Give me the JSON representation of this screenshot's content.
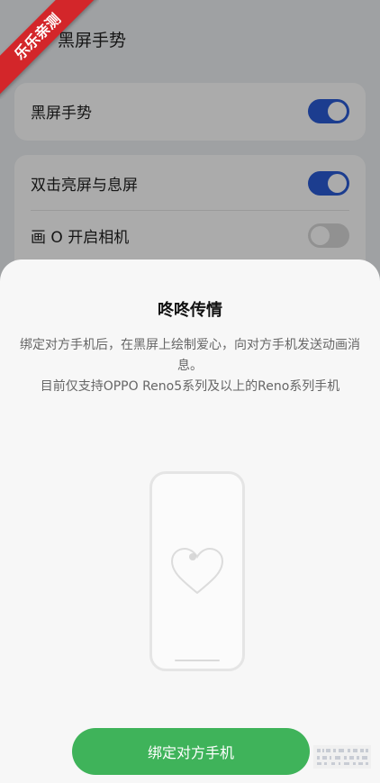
{
  "watermark": "乐乐亲测",
  "settings": {
    "page_title": "黑屏手势",
    "items": [
      {
        "label": "黑屏手势",
        "on": true
      },
      {
        "label": "双击亮屏与息屏",
        "on": true
      },
      {
        "label": "画 O 开启相机",
        "on": false
      }
    ]
  },
  "sheet": {
    "title": "咚咚传情",
    "description_line1": "绑定对方手机后，在黑屏上绘制爱心，向对方手机发送动画消息。",
    "description_line2": "目前仅支持OPPO Reno5系列及以上的Reno系列手机",
    "button_label": "绑定对方手机"
  },
  "colors": {
    "toggle_on": "#2a5bd6",
    "button": "#3fb35a",
    "watermark": "#d3262a"
  }
}
